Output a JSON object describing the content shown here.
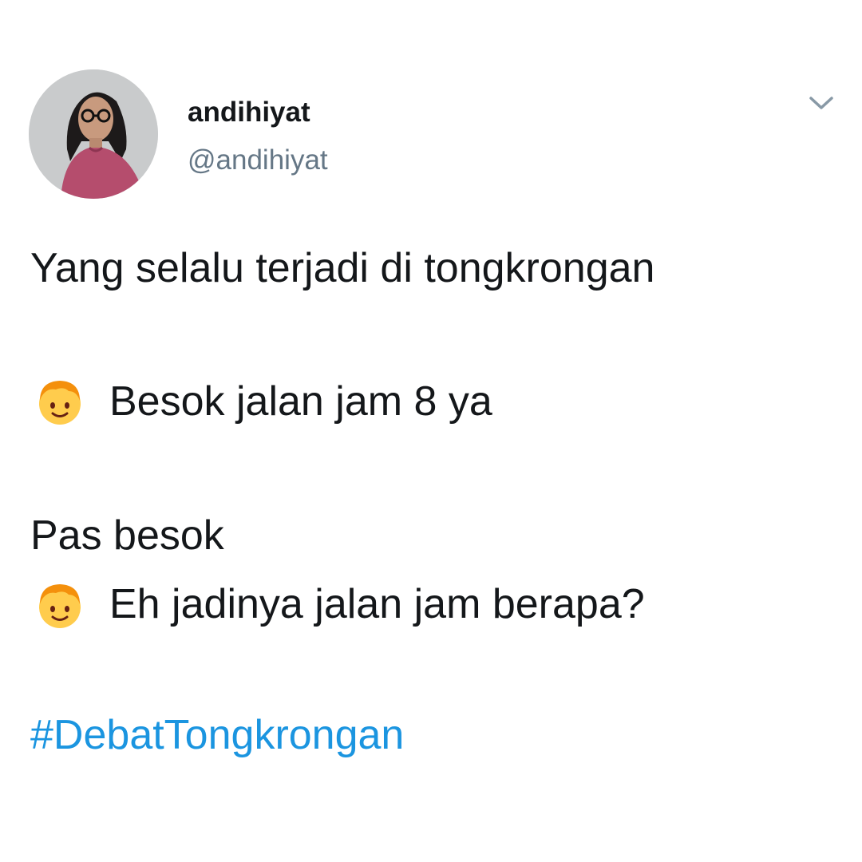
{
  "user": {
    "display_name": "andihiyat",
    "handle": "@andihiyat"
  },
  "tweet": {
    "line1": "Yang selalu terjadi di tongkrongan",
    "line2": "Besok jalan jam 8 ya",
    "line3": "Pas besok",
    "line4": "Eh jadinya jalan jam berapa?",
    "hashtag": "#DebatTongkrongan"
  },
  "icons": {
    "menu": "chevron-down-icon",
    "emoji": "boy-face-emoji"
  },
  "colors": {
    "text": "#14171a",
    "secondary": "#657786",
    "link": "#1b95e0",
    "emoji_face": "#ffcc4d",
    "emoji_hair": "#f4900c"
  }
}
